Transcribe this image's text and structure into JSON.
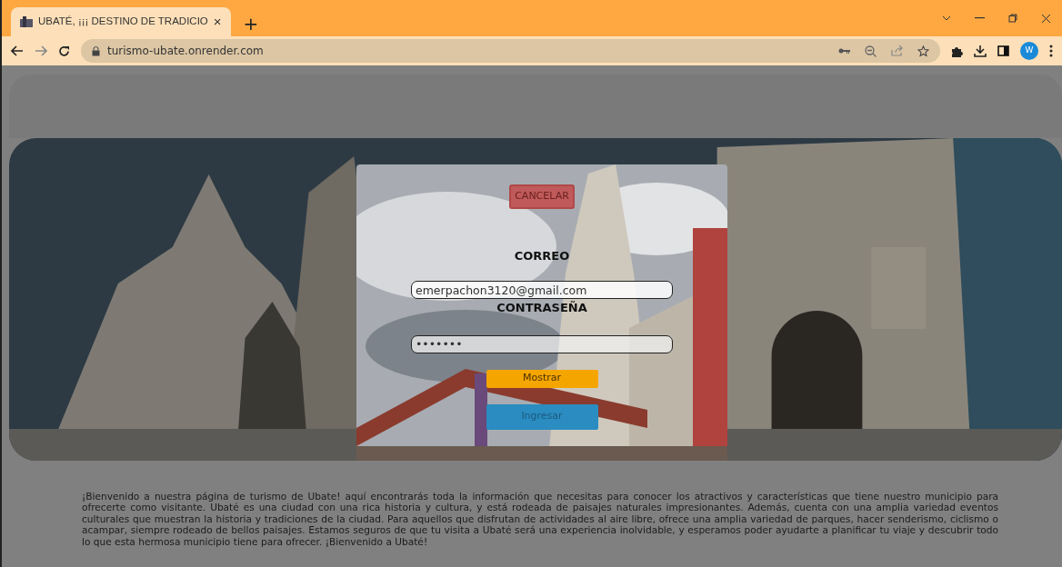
{
  "browser": {
    "tabs": [
      {
        "title": "UBATÉ, ¡¡¡ DESTINO DE TRADICIO",
        "close": "×",
        "selected": true
      }
    ],
    "new_tab": "+",
    "url": "turismo-ubate.onrender.com",
    "profile": "W"
  },
  "login": {
    "cancel": "CANCELAR",
    "email_label": "CORREO",
    "email_value": "emerpachon3120@gmail.com",
    "password_label": "CONTRASEÑA",
    "password_value": "•••••••",
    "show_button": "Mostrar",
    "submit_button": "Ingresar"
  },
  "intro": "¡Bienvenido a nuestra página de turismo de Ubate! aquí encontrarás toda la información que necesitas para conocer los atractivos y características que tiene nuestro municipio para ofrecerte como visitante. Ubaté es una ciudad con una rica historia y cultura, y está rodeada de paisajes naturales impresionantes. Además, cuenta con una amplia variedad eventos culturales que muestran la historia y tradiciones de la ciudad. Para aquellos que disfrutan de actividades al aire libre, ofrece una amplia variedad de parques, hacer senderismo, ciclismo o acampar, siempre rodeado de bellos paisajes. Estamos seguros de que tu visita a Ubaté será una experiencia inolvidable, y esperamos poder ayudarte a planificar tu viaje y descubrir todo lo que esta hermosa municipio tiene para ofrecer. ¡Bienvenido a Ubaté!"
}
